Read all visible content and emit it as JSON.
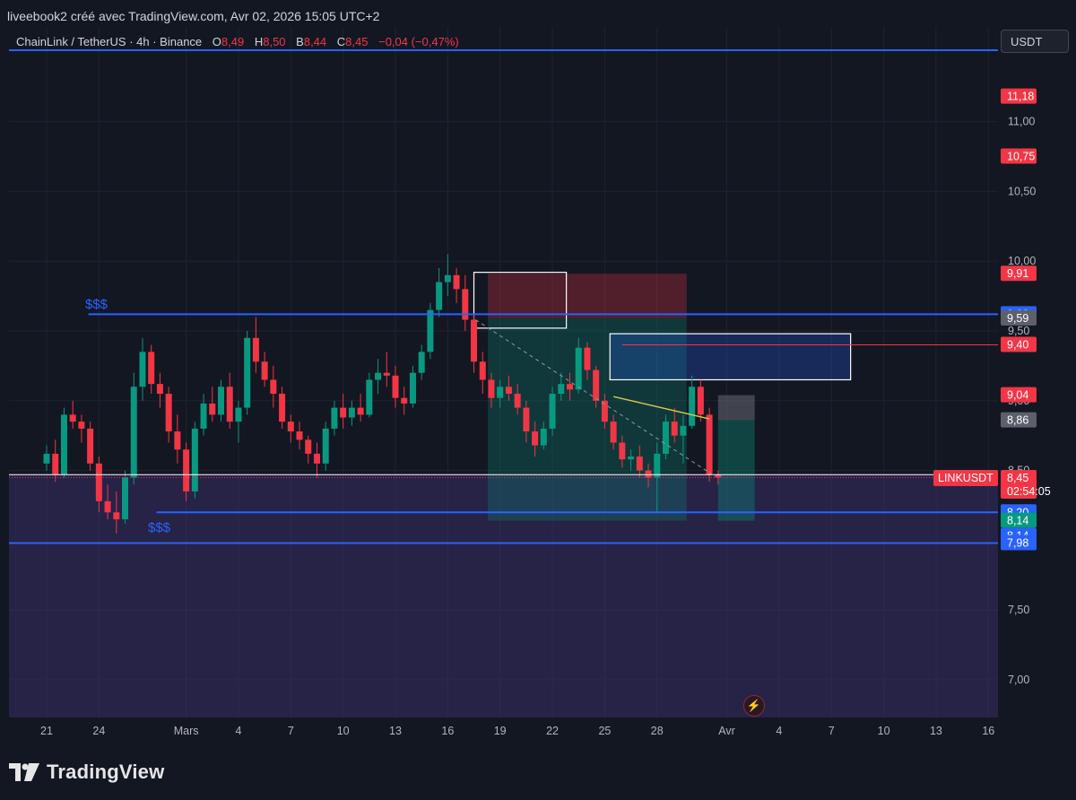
{
  "header": {
    "caption": "liveebook2 créé avec TradingView.com, Avr 02, 2026 15:05 UTC+2"
  },
  "legend": {
    "symbol": "ChainLink / TetherUS · 4h · Binance",
    "o_label": "O",
    "o_value": "8,49",
    "h_label": "H",
    "h_value": "8,50",
    "b_label": "B",
    "b_value": "8,44",
    "c_label": "C",
    "c_value": "8,45",
    "change": "−0,04 (−0,47%)"
  },
  "currency_button": "USDT",
  "annotations": {
    "liquidity_high": "$$$",
    "liquidity_low": "$$$"
  },
  "branding": {
    "logo_text": "TradingView",
    "logo_icon": "tradingview-logo-icon"
  },
  "flash_icon": "lightning-icon",
  "colors": {
    "background": "#131722",
    "up": "#089981",
    "down": "#f23645",
    "level_line": "#2962ff",
    "supply_zone": "#f23645",
    "demand_zone": "#089981",
    "range_zone": "#4a3a8a"
  },
  "chart_data": {
    "type": "candlestick",
    "symbol": "LINKUSDT",
    "interval": "4h",
    "last_price": 8.45,
    "ylim": [
      6.7,
      11.55
    ],
    "yticks": [
      "11,00",
      "10,50",
      "10,00",
      "9,50",
      "9,00",
      "8,50",
      "7,50",
      "7,00"
    ],
    "ytick_values": [
      11.0,
      10.5,
      10.0,
      9.5,
      9.0,
      8.5,
      7.5,
      7.0
    ],
    "xticks": [
      "21",
      "24",
      "Mars",
      "4",
      "7",
      "10",
      "13",
      "16",
      "19",
      "22",
      "25",
      "28",
      "Avr",
      "4",
      "7",
      "10",
      "13",
      "16"
    ],
    "xtick_days": [
      0,
      3,
      8,
      11,
      14,
      17,
      20,
      23,
      26,
      29,
      32,
      35,
      39,
      42,
      45,
      48,
      51,
      54
    ],
    "horizontal_levels": [
      9.62,
      8.2,
      7.98,
      11.62
    ],
    "price_labels": [
      {
        "text": "11,18",
        "value": 11.18,
        "color": "#f23645"
      },
      {
        "text": "10,75",
        "value": 10.75,
        "color": "#f23645"
      },
      {
        "text": "9,91",
        "value": 9.91,
        "color": "#f23645"
      },
      {
        "text": "9,62",
        "value": 9.62,
        "color": "#2962ff"
      },
      {
        "text": "9,59",
        "value": 9.59,
        "color": "#5d606b"
      },
      {
        "text": "9,40",
        "value": 9.4,
        "color": "#f23645"
      },
      {
        "text": "9,04",
        "value": 9.04,
        "color": "#f23645"
      },
      {
        "text": "8,86",
        "value": 8.86,
        "color": "#5d606b"
      },
      {
        "text": "8,20",
        "value": 8.2,
        "color": "#2962ff"
      },
      {
        "text": "8,14",
        "value": 8.14,
        "color": "#089981"
      },
      {
        "text": "8,14",
        "value": 8.14,
        "color": "#2962ff"
      },
      {
        "text": "7,98",
        "value": 7.98,
        "color": "#2962ff"
      }
    ],
    "last_price_label": {
      "symbol": "LINKUSDT",
      "price": "8,45",
      "countdown": "02:54:05"
    },
    "candles": [
      {
        "day": 0.0,
        "o": 8.55,
        "h": 8.68,
        "l": 8.5,
        "c": 8.62
      },
      {
        "day": 0.5,
        "o": 8.62,
        "h": 8.72,
        "l": 8.42,
        "c": 8.47
      },
      {
        "day": 1.0,
        "o": 8.47,
        "h": 8.95,
        "l": 8.45,
        "c": 8.9
      },
      {
        "day": 1.5,
        "o": 8.9,
        "h": 9.0,
        "l": 8.8,
        "c": 8.85
      },
      {
        "day": 2.0,
        "o": 8.85,
        "h": 8.9,
        "l": 8.7,
        "c": 8.8
      },
      {
        "day": 2.5,
        "o": 8.8,
        "h": 8.85,
        "l": 8.5,
        "c": 8.55
      },
      {
        "day": 3.0,
        "o": 8.55,
        "h": 8.6,
        "l": 8.2,
        "c": 8.28
      },
      {
        "day": 3.5,
        "o": 8.28,
        "h": 8.4,
        "l": 8.15,
        "c": 8.2
      },
      {
        "day": 4.0,
        "o": 8.2,
        "h": 8.35,
        "l": 8.05,
        "c": 8.15
      },
      {
        "day": 4.5,
        "o": 8.15,
        "h": 8.5,
        "l": 8.12,
        "c": 8.45
      },
      {
        "day": 5.0,
        "o": 8.45,
        "h": 9.2,
        "l": 8.4,
        "c": 9.1
      },
      {
        "day": 5.5,
        "o": 9.1,
        "h": 9.45,
        "l": 9.0,
        "c": 9.35
      },
      {
        "day": 6.0,
        "o": 9.35,
        "h": 9.4,
        "l": 9.05,
        "c": 9.12
      },
      {
        "day": 6.5,
        "o": 9.12,
        "h": 9.2,
        "l": 8.95,
        "c": 9.05
      },
      {
        "day": 7.0,
        "o": 9.05,
        "h": 9.1,
        "l": 8.7,
        "c": 8.78
      },
      {
        "day": 7.5,
        "o": 8.78,
        "h": 8.9,
        "l": 8.55,
        "c": 8.65
      },
      {
        "day": 8.0,
        "o": 8.65,
        "h": 8.7,
        "l": 8.28,
        "c": 8.35
      },
      {
        "day": 8.5,
        "o": 8.35,
        "h": 8.85,
        "l": 8.3,
        "c": 8.8
      },
      {
        "day": 9.0,
        "o": 8.8,
        "h": 9.05,
        "l": 8.75,
        "c": 8.98
      },
      {
        "day": 9.5,
        "o": 8.98,
        "h": 9.1,
        "l": 8.85,
        "c": 8.9
      },
      {
        "day": 10.0,
        "o": 8.9,
        "h": 9.15,
        "l": 8.85,
        "c": 9.1
      },
      {
        "day": 10.5,
        "o": 9.1,
        "h": 9.2,
        "l": 8.8,
        "c": 8.85
      },
      {
        "day": 11.0,
        "o": 8.85,
        "h": 9.0,
        "l": 8.7,
        "c": 8.95
      },
      {
        "day": 11.5,
        "o": 8.95,
        "h": 9.5,
        "l": 8.9,
        "c": 9.45
      },
      {
        "day": 12.0,
        "o": 9.45,
        "h": 9.6,
        "l": 9.2,
        "c": 9.28
      },
      {
        "day": 12.5,
        "o": 9.28,
        "h": 9.35,
        "l": 9.1,
        "c": 9.15
      },
      {
        "day": 13.0,
        "o": 9.15,
        "h": 9.25,
        "l": 8.95,
        "c": 9.05
      },
      {
        "day": 13.5,
        "o": 9.05,
        "h": 9.1,
        "l": 8.8,
        "c": 8.85
      },
      {
        "day": 14.0,
        "o": 8.85,
        "h": 8.9,
        "l": 8.7,
        "c": 8.78
      },
      {
        "day": 14.5,
        "o": 8.78,
        "h": 8.85,
        "l": 8.65,
        "c": 8.72
      },
      {
        "day": 15.0,
        "o": 8.72,
        "h": 8.75,
        "l": 8.55,
        "c": 8.62
      },
      {
        "day": 15.5,
        "o": 8.62,
        "h": 8.7,
        "l": 8.45,
        "c": 8.55
      },
      {
        "day": 16.0,
        "o": 8.55,
        "h": 8.85,
        "l": 8.5,
        "c": 8.8
      },
      {
        "day": 16.5,
        "o": 8.8,
        "h": 9.0,
        "l": 8.75,
        "c": 8.95
      },
      {
        "day": 17.0,
        "o": 8.95,
        "h": 9.05,
        "l": 8.8,
        "c": 8.88
      },
      {
        "day": 17.5,
        "o": 8.88,
        "h": 9.0,
        "l": 8.82,
        "c": 8.95
      },
      {
        "day": 18.0,
        "o": 8.95,
        "h": 9.05,
        "l": 8.85,
        "c": 8.9
      },
      {
        "day": 18.5,
        "o": 8.9,
        "h": 9.2,
        "l": 8.88,
        "c": 9.15
      },
      {
        "day": 19.0,
        "o": 9.15,
        "h": 9.3,
        "l": 9.05,
        "c": 9.2
      },
      {
        "day": 19.5,
        "o": 9.2,
        "h": 9.35,
        "l": 9.1,
        "c": 9.18
      },
      {
        "day": 20.0,
        "o": 9.18,
        "h": 9.25,
        "l": 8.95,
        "c": 9.02
      },
      {
        "day": 20.5,
        "o": 9.02,
        "h": 9.1,
        "l": 8.9,
        "c": 8.98
      },
      {
        "day": 21.0,
        "o": 8.98,
        "h": 9.25,
        "l": 8.95,
        "c": 9.2
      },
      {
        "day": 21.5,
        "o": 9.2,
        "h": 9.4,
        "l": 9.15,
        "c": 9.35
      },
      {
        "day": 22.0,
        "o": 9.35,
        "h": 9.7,
        "l": 9.3,
        "c": 9.65
      },
      {
        "day": 22.5,
        "o": 9.65,
        "h": 9.95,
        "l": 9.6,
        "c": 9.85
      },
      {
        "day": 23.0,
        "o": 9.85,
        "h": 10.05,
        "l": 9.75,
        "c": 9.9
      },
      {
        "day": 23.5,
        "o": 9.9,
        "h": 9.95,
        "l": 9.7,
        "c": 9.8
      },
      {
        "day": 24.0,
        "o": 9.8,
        "h": 9.9,
        "l": 9.5,
        "c": 9.58
      },
      {
        "day": 24.5,
        "o": 9.58,
        "h": 9.62,
        "l": 9.2,
        "c": 9.28
      },
      {
        "day": 25.0,
        "o": 9.28,
        "h": 9.35,
        "l": 9.05,
        "c": 9.15
      },
      {
        "day": 25.5,
        "o": 9.15,
        "h": 9.2,
        "l": 8.95,
        "c": 9.02
      },
      {
        "day": 26.0,
        "o": 9.02,
        "h": 9.15,
        "l": 8.95,
        "c": 9.1
      },
      {
        "day": 26.5,
        "o": 9.1,
        "h": 9.18,
        "l": 9.0,
        "c": 9.05
      },
      {
        "day": 27.0,
        "o": 9.05,
        "h": 9.12,
        "l": 8.9,
        "c": 8.95
      },
      {
        "day": 27.5,
        "o": 8.95,
        "h": 9.0,
        "l": 8.7,
        "c": 8.78
      },
      {
        "day": 28.0,
        "o": 8.78,
        "h": 8.85,
        "l": 8.6,
        "c": 8.68
      },
      {
        "day": 28.5,
        "o": 8.68,
        "h": 8.85,
        "l": 8.65,
        "c": 8.8
      },
      {
        "day": 29.0,
        "o": 8.8,
        "h": 9.1,
        "l": 8.75,
        "c": 9.05
      },
      {
        "day": 29.5,
        "o": 9.05,
        "h": 9.2,
        "l": 9.0,
        "c": 9.12
      },
      {
        "day": 30.0,
        "o": 9.12,
        "h": 9.2,
        "l": 9.0,
        "c": 9.08
      },
      {
        "day": 30.5,
        "o": 9.08,
        "h": 9.45,
        "l": 9.05,
        "c": 9.38
      },
      {
        "day": 31.0,
        "o": 9.38,
        "h": 9.42,
        "l": 9.15,
        "c": 9.22
      },
      {
        "day": 31.5,
        "o": 9.22,
        "h": 9.25,
        "l": 8.95,
        "c": 9.0
      },
      {
        "day": 32.0,
        "o": 9.0,
        "h": 9.05,
        "l": 8.8,
        "c": 8.85
      },
      {
        "day": 32.5,
        "o": 8.85,
        "h": 8.9,
        "l": 8.65,
        "c": 8.7
      },
      {
        "day": 33.0,
        "o": 8.7,
        "h": 8.75,
        "l": 8.52,
        "c": 8.58
      },
      {
        "day": 33.5,
        "o": 8.58,
        "h": 8.65,
        "l": 8.5,
        "c": 8.6
      },
      {
        "day": 34.0,
        "o": 8.6,
        "h": 8.68,
        "l": 8.45,
        "c": 8.5
      },
      {
        "day": 34.5,
        "o": 8.5,
        "h": 8.55,
        "l": 8.38,
        "c": 8.45
      },
      {
        "day": 35.0,
        "o": 8.45,
        "h": 8.7,
        "l": 8.2,
        "c": 8.62
      },
      {
        "day": 35.5,
        "o": 8.62,
        "h": 8.9,
        "l": 8.58,
        "c": 8.85
      },
      {
        "day": 36.0,
        "o": 8.85,
        "h": 8.95,
        "l": 8.7,
        "c": 8.75
      },
      {
        "day": 36.5,
        "o": 8.75,
        "h": 8.9,
        "l": 8.55,
        "c": 8.82
      },
      {
        "day": 37.0,
        "o": 8.82,
        "h": 9.18,
        "l": 8.8,
        "c": 9.1
      },
      {
        "day": 37.5,
        "o": 9.1,
        "h": 9.15,
        "l": 8.85,
        "c": 8.9
      },
      {
        "day": 38.0,
        "o": 8.9,
        "h": 8.95,
        "l": 8.42,
        "c": 8.47
      },
      {
        "day": 38.5,
        "o": 8.47,
        "h": 8.5,
        "l": 8.4,
        "c": 8.45
      }
    ]
  }
}
